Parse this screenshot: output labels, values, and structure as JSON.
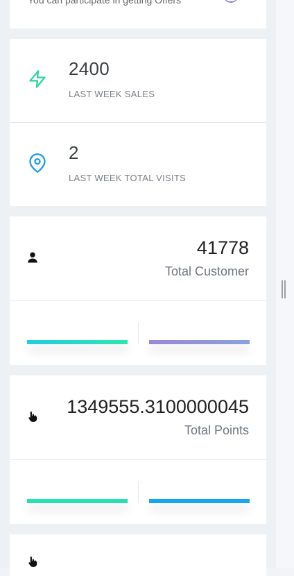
{
  "offers_card": {
    "partial_text": "You can participate in getting Offers"
  },
  "stats": [
    {
      "value": "2400",
      "label": "LAST WEEK SALES",
      "icon": "lightning-icon",
      "color": "#2fd6a3"
    },
    {
      "value": "2",
      "label": "LAST WEEK TOTAL VISITS",
      "icon": "location-pin-icon",
      "color": "#1e9de8"
    }
  ],
  "customers": {
    "value": "41778",
    "label": "Total Customer",
    "icon": "user-icon",
    "bars": {
      "left": {
        "color_start": "#24cbe3",
        "color_end": "#2ee6b0",
        "fill": 1
      },
      "right": {
        "color_start": "#9b86d9",
        "color_end": "#8aa2dc",
        "fill": 1
      }
    }
  },
  "points": {
    "value": "1349555.3100000045",
    "label": "Total Points",
    "icon": "hand-pointer-icon",
    "bars": {
      "left": {
        "color_start": "#25e1b2",
        "color_end": "#25e1b2",
        "fill": 1
      },
      "right": {
        "color_start": "#14a6ef",
        "color_end": "#14a6ef",
        "fill": 1
      }
    }
  },
  "partial_card": {
    "icon": "hand-pointer-icon"
  }
}
